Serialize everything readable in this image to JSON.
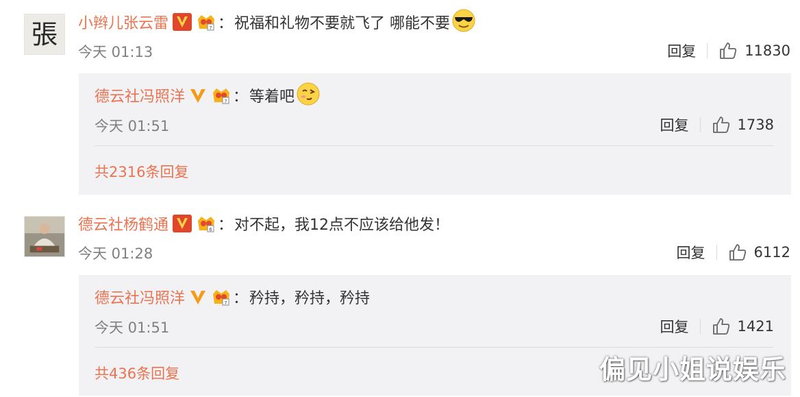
{
  "comments": [
    {
      "username": "小辫儿张云雷",
      "text": "祝福和礼物不要就飞了 哪能不要",
      "time": "今天 01:13",
      "reply_label": "回复",
      "likes": "11830",
      "reply": {
        "username": "德云社冯照洋",
        "text": "等着吧",
        "time": "今天 01:51",
        "reply_label": "回复",
        "likes": "1738"
      },
      "more_replies": "共2316条回复"
    },
    {
      "username": "德云社杨鹤通",
      "text": "对不起，我12点不应该给他发！",
      "time": "今天 01:28",
      "reply_label": "回复",
      "likes": "6112",
      "reply": {
        "username": "德云社冯照洋",
        "text": "矜持，矜持，矜持",
        "time": "今天 01:51",
        "reply_label": "回复",
        "likes": "1421"
      },
      "more_replies": "共436条回复"
    }
  ],
  "colon": "：",
  "watermark": "偏见小姐说娱乐",
  "avatar_1_text": "張",
  "colors": {
    "username": "#eb7350",
    "reply_bg": "#f2f2f5",
    "time": "#808080",
    "vip_orange": "#f59b18",
    "vip_red": "#e0462a"
  },
  "icons": [
    "vip-v-badge-icon",
    "crown-badge-icon",
    "thumb-up-icon",
    "sunglasses-emoji-icon",
    "wink-emoji-icon"
  ]
}
